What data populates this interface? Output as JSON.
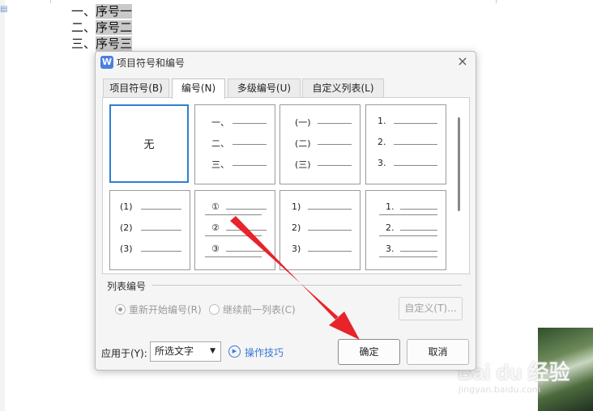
{
  "document": {
    "lines": [
      {
        "prefix": "一、",
        "text": "序号一"
      },
      {
        "prefix": "二、",
        "text": "序号二"
      },
      {
        "prefix": "三、",
        "text": "序号三"
      }
    ]
  },
  "watermark": {
    "brand": "Bai du 经验",
    "site": "jingyan.baidu.com"
  },
  "dialog": {
    "app_icon_letter": "W",
    "title": "项目符号和编号",
    "tabs": [
      {
        "label": "项目符号(B)",
        "active": false
      },
      {
        "label": "编号(N)",
        "active": true
      },
      {
        "label": "多级编号(U)",
        "active": false
      },
      {
        "label": "自定义列表(L)",
        "active": false
      }
    ],
    "numbering_styles": [
      {
        "id": "none",
        "label": "无",
        "selected": true,
        "items": []
      },
      {
        "id": "chinese",
        "selected": false,
        "items": [
          "一、",
          "二、",
          "三、"
        ]
      },
      {
        "id": "paren-chinese",
        "selected": false,
        "items": [
          "(一)",
          "(二)",
          "(三)"
        ]
      },
      {
        "id": "arabic-dot",
        "selected": false,
        "items": [
          "1.",
          "2.",
          "3."
        ]
      },
      {
        "id": "paren-arabic",
        "selected": false,
        "items": [
          "(1)",
          "(2)",
          "(3)"
        ]
      },
      {
        "id": "circled",
        "selected": false,
        "items": [
          "①",
          "②",
          "③"
        ]
      },
      {
        "id": "arabic-paren",
        "selected": false,
        "items": [
          "1)",
          "2)",
          "3)"
        ]
      },
      {
        "id": "arabic-dot-indent",
        "selected": false,
        "items": [
          "1.",
          "2.",
          "3."
        ]
      }
    ],
    "list_numbering": {
      "section_title": "列表编号",
      "restart_label": "重新开始编号(R)",
      "restart_checked": true,
      "continue_label": "继续前一列表(C)",
      "continue_checked": false,
      "custom_label": "自定义(T)..."
    },
    "footer": {
      "apply_to_label": "应用于(Y):",
      "apply_to_value": "所选文字",
      "tips_label": "操作技巧",
      "ok_label": "确定",
      "cancel_label": "取消"
    }
  },
  "colors": {
    "accent": "#2d7fd1",
    "link": "#3a78d8",
    "arrow": "#e8232a"
  }
}
